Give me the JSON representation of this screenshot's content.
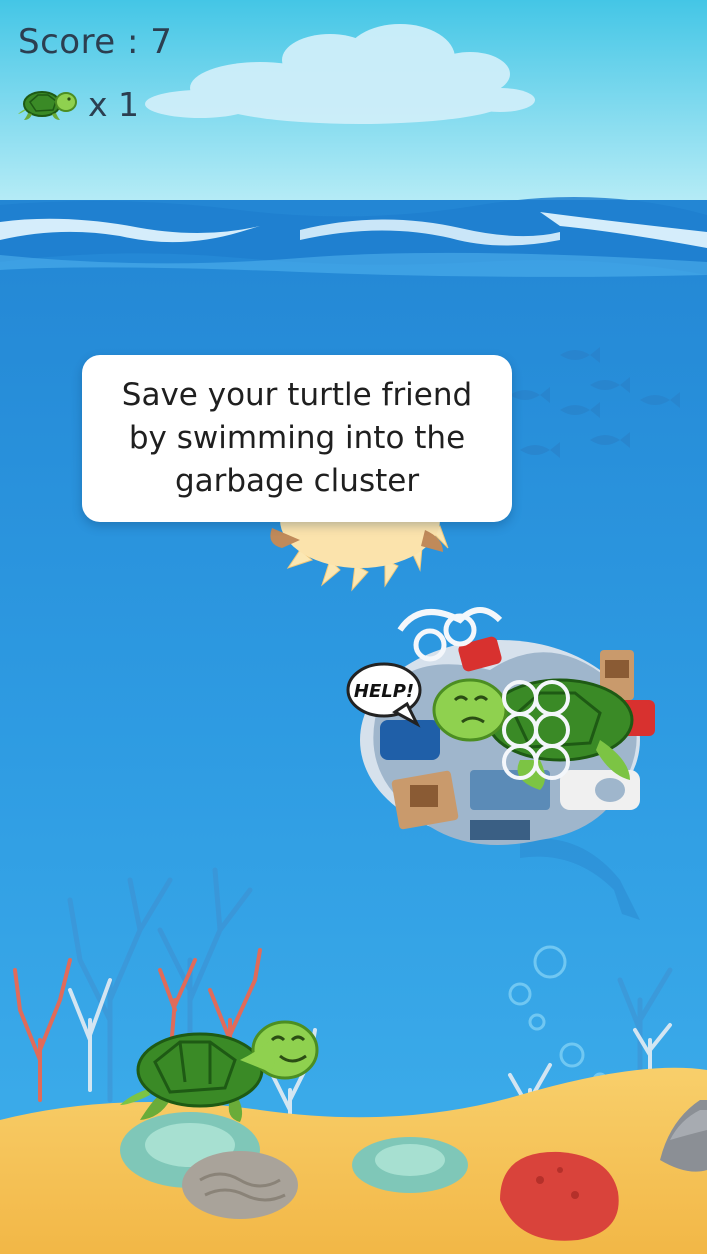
{
  "hud": {
    "score_text": "Score : 7",
    "lives_icon": "turtle-icon",
    "lives_text": "x 1"
  },
  "tooltip": {
    "message": "Save your turtle friend\nby swimming into the\ngarbage cluster"
  },
  "speech_bubble": {
    "text": "HELP!"
  },
  "colors": {
    "sky_top": "#4fcde9",
    "sky_bottom": "#b9ecf5",
    "ocean_top": "#2a8fd9",
    "ocean_bottom": "#3aa6e6",
    "sand": "#f6c35a",
    "turtle_shell": "#3f8f2a",
    "turtle_skin": "#8fd14f"
  }
}
